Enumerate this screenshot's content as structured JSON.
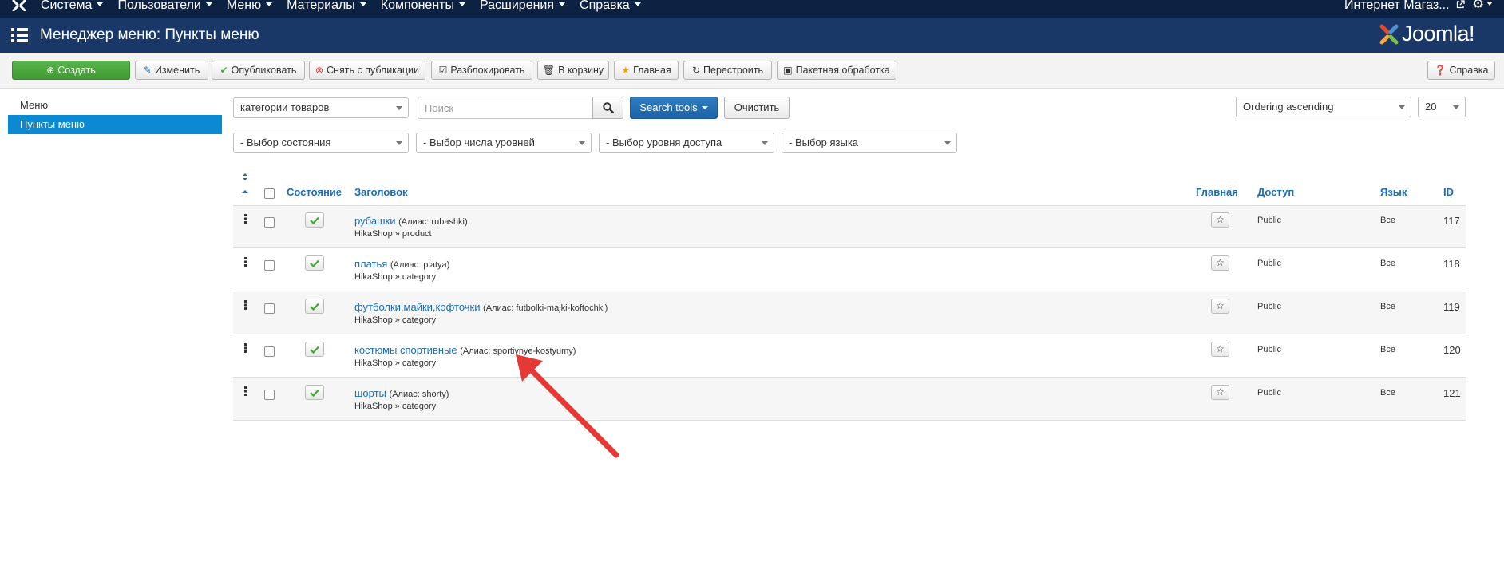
{
  "nav": {
    "items": [
      "Система",
      "Пользователи",
      "Меню",
      "Материалы",
      "Компоненты",
      "Расширения",
      "Справка"
    ],
    "site_link": "Интернет Магаз...",
    "icons": [
      "joomla-icon",
      "external-link-icon",
      "gear-icon"
    ]
  },
  "header": {
    "title": "Менеджер меню: Пункты меню",
    "logo_text": "Joomla!"
  },
  "toolbar": {
    "create": "Создать",
    "edit": "Изменить",
    "publish": "Опубликовать",
    "unpublish": "Снять с публикации",
    "unlock": "Разблокировать",
    "trash": "В корзину",
    "home": "Главная",
    "rebuild": "Перестроить",
    "batch": "Пакетная обработка",
    "help": "Справка"
  },
  "sidebar": {
    "items": [
      {
        "label": "Меню",
        "active": false
      },
      {
        "label": "Пункты меню",
        "active": true
      }
    ]
  },
  "filters": {
    "menu_select": "категории товаров",
    "search_placeholder": "Поиск",
    "search_tools": "Search tools",
    "clear": "Очистить",
    "ordering": "Ordering ascending",
    "limit": "20",
    "state": "- Выбор состояния",
    "levels": "- Выбор числа уровней",
    "access": "- Выбор уровня доступа",
    "language": "- Выбор языка"
  },
  "table": {
    "headers": {
      "status": "Состояние",
      "title": "Заголовок",
      "home": "Главная",
      "access": "Доступ",
      "language": "Язык",
      "id": "ID"
    },
    "rows": [
      {
        "title": "рубашки",
        "alias": "(Алиас: rubashki)",
        "type": "HikaShop » product",
        "access": "Public",
        "language": "Все",
        "id": "117"
      },
      {
        "title": "платья",
        "alias": "(Алиас: platya)",
        "type": "HikaShop » category",
        "access": "Public",
        "language": "Все",
        "id": "118"
      },
      {
        "title": "футболки,майки,кофточки",
        "alias": "(Алиас: futbolki-majki-koftochki)",
        "type": "HikaShop » category",
        "access": "Public",
        "language": "Все",
        "id": "119"
      },
      {
        "title": "костюмы спортивные",
        "alias": "(Алиас: sportivnye-kostyumy)",
        "type": "HikaShop » category",
        "access": "Public",
        "language": "Все",
        "id": "120"
      },
      {
        "title": "шорты",
        "alias": "(Алиас: shorty)",
        "type": "HikaShop » category",
        "access": "Public",
        "language": "Все",
        "id": "121"
      }
    ]
  },
  "colors": {
    "navbar": "#0d2243",
    "titlebar": "#1a3867",
    "accent": "#0b89d2",
    "link": "#1b6db8",
    "create_button": "#46a538",
    "annotation_arrow": "#e53935"
  }
}
